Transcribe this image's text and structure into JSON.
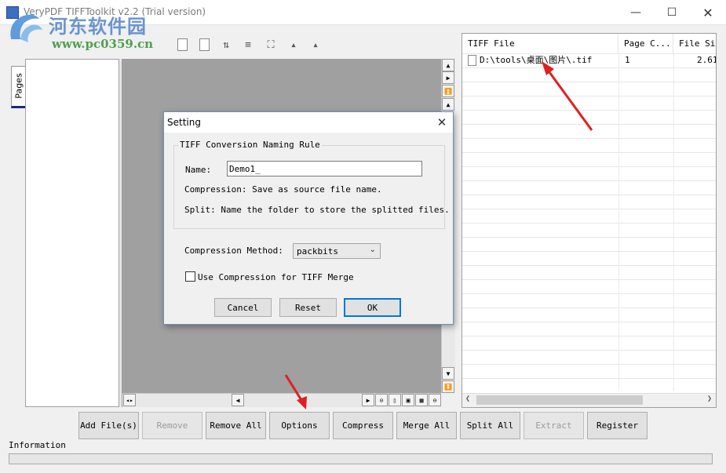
{
  "window": {
    "title": "VeryPDF TIFFToolkit v2.2 (Trial version)",
    "min_glyph": "—",
    "max_glyph": "☐",
    "close_glyph": "✕"
  },
  "watermark": {
    "site_name": "河东软件园",
    "url": "www.pc0359.cn"
  },
  "thumbnails": {
    "tab_label": "Pages"
  },
  "file_list": {
    "columns": [
      "TIFF File",
      "Page C...",
      "File Siz"
    ],
    "rows": [
      {
        "file": "D:\\tools\\桌面\\图片\\.tif",
        "pages": "1",
        "size": "2.61"
      }
    ]
  },
  "buttons": {
    "add_files": "Add File(s)",
    "remove": "Remove",
    "remove_all": "Remove All",
    "options": "Options",
    "compress": "Compress",
    "merge_all": "Merge All",
    "split_all": "Split All",
    "extract": "Extract",
    "register": "Register"
  },
  "information": {
    "label": "Information"
  },
  "dialog": {
    "title": "Setting",
    "close_glyph": "✕",
    "group_title": "TIFF Conversion Naming Rule",
    "name_label": "Name:",
    "name_value": "Demo1_",
    "compression_note": "Compression: Save as source file name.",
    "split_note": "Split: Name the folder to store the splitted files.",
    "method_label": "Compression Method:",
    "method_value": "packbits",
    "merge_checkbox_label": "Use Compression for TIFF Merge",
    "merge_checked": false,
    "cancel": "Cancel",
    "reset": "Reset",
    "ok": "OK"
  },
  "colors": {
    "accent": "#0078d7",
    "annotation_arrow": "#e02020",
    "preview_background": "#a0a0a0"
  },
  "icons": {
    "toolbar": [
      "page-icon",
      "page-icon",
      "flip-icon",
      "rotate-icon",
      "fit-icon",
      "up-icon",
      "up-icon"
    ],
    "scroll": [
      "arrow-up-icon",
      "arrow-right-icon",
      "arrow-top-icon",
      "arrow-up-icon",
      "arrow-down-icon",
      "arrow-bottom-icon"
    ]
  }
}
